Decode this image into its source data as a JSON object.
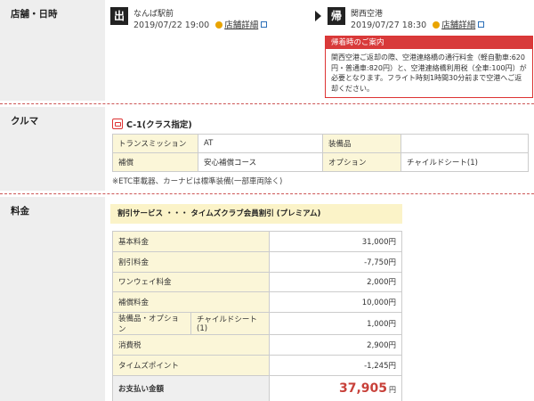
{
  "store_date": {
    "label": "店舗・日時",
    "pickup": {
      "badge": "出",
      "location": "なんば駅前",
      "datetime": "2019/07/22 19:00",
      "link": "店舗詳細"
    },
    "return": {
      "badge": "帰",
      "location": "関西空港",
      "datetime": "2019/07/27 18:30",
      "link": "店舗詳細"
    },
    "notice": {
      "title": "帰着時のご案内",
      "body": "関西空港ご返却の際、空港連絡橋の通行料金（軽自動車:620円・普通車:820円）と、空港連絡橋利用税（全車:100円）が必要となります。フライト時刻1時間30分前まで空港へご返却ください。"
    }
  },
  "car": {
    "label": "クルマ",
    "title": "C-1(クラス指定)",
    "table": [
      [
        "トランスミッション",
        "AT",
        "装備品",
        ""
      ],
      [
        "補償",
        "安心補償コース",
        "オプション",
        "チャイルドシート(1)"
      ]
    ],
    "note": "※ETC車載器、カーナビは標準装備(一部車両除く)"
  },
  "fees": {
    "label": "料金",
    "discount": "割引サービス ・・・ タイムズクラブ会員割引 (プレミアム)",
    "rows": [
      {
        "k": "基本料金",
        "v": "31,000円"
      },
      {
        "k": "割引料金",
        "v": "-7,750円"
      },
      {
        "k": "ワンウェイ料金",
        "v": "2,000円"
      },
      {
        "k": "補償料金",
        "v": "10,000円"
      },
      {
        "k": "装備品・オプション",
        "sub": "チャイルドシート(1)",
        "v": "1,000円"
      },
      {
        "k": "消費税",
        "v": "2,900円"
      },
      {
        "k": "タイムズポイント",
        "v": "-1,245円"
      }
    ],
    "total_label": "お支払い金額",
    "total_value": "37,905",
    "total_unit": "円"
  },
  "colors": {
    "accent_red": "#d83a3a",
    "label_bg": "#eeeeee",
    "key_bg": "#fbf6d8",
    "bullet_orange": "#e9a400"
  }
}
